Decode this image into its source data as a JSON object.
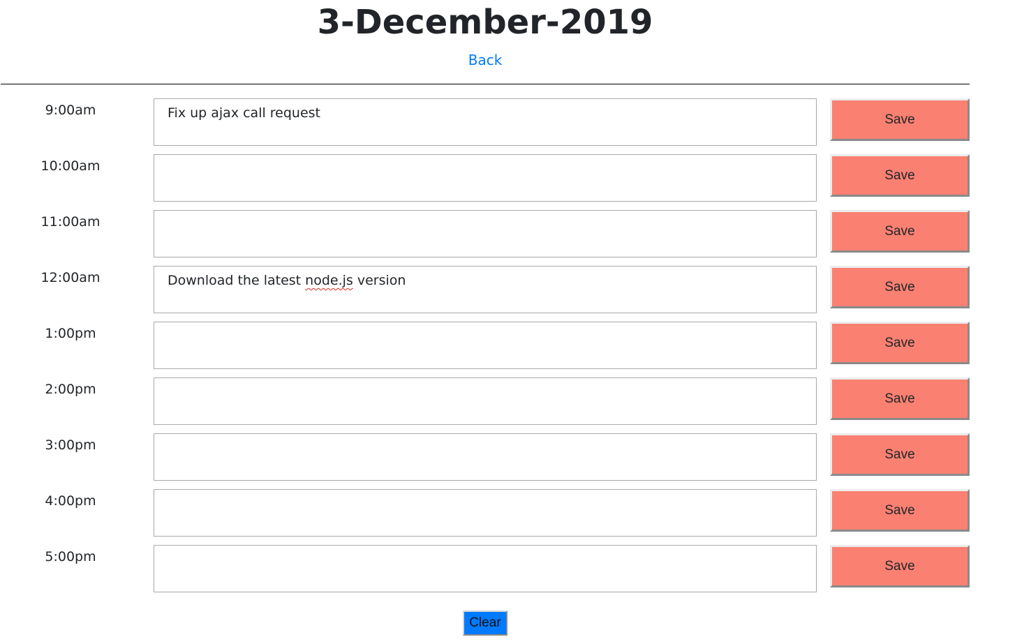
{
  "page": {
    "title": "3-December-2019",
    "back_label": "Back"
  },
  "schedule": [
    {
      "hour": "9:00am",
      "task_parts": [
        "Fix up ajax call request"
      ],
      "save_label": "Save"
    },
    {
      "hour": "10:00am",
      "task_parts": [],
      "save_label": "Save"
    },
    {
      "hour": "11:00am",
      "task_parts": [],
      "save_label": "Save"
    },
    {
      "hour": "12:00am",
      "task_parts": [
        "Download the latest ",
        "node.js",
        " version"
      ],
      "save_label": "Save"
    },
    {
      "hour": "1:00pm",
      "task_parts": [],
      "save_label": "Save"
    },
    {
      "hour": "2:00pm",
      "task_parts": [],
      "save_label": "Save"
    },
    {
      "hour": "3:00pm",
      "task_parts": [],
      "save_label": "Save"
    },
    {
      "hour": "4:00pm",
      "task_parts": [],
      "save_label": "Save"
    },
    {
      "hour": "5:00pm",
      "task_parts": [],
      "save_label": "Save"
    }
  ],
  "footer": {
    "clear_label": "Clear"
  },
  "colors": {
    "save_button": "#fa8072",
    "clear_button": "#007bff",
    "link": "#007bff"
  }
}
